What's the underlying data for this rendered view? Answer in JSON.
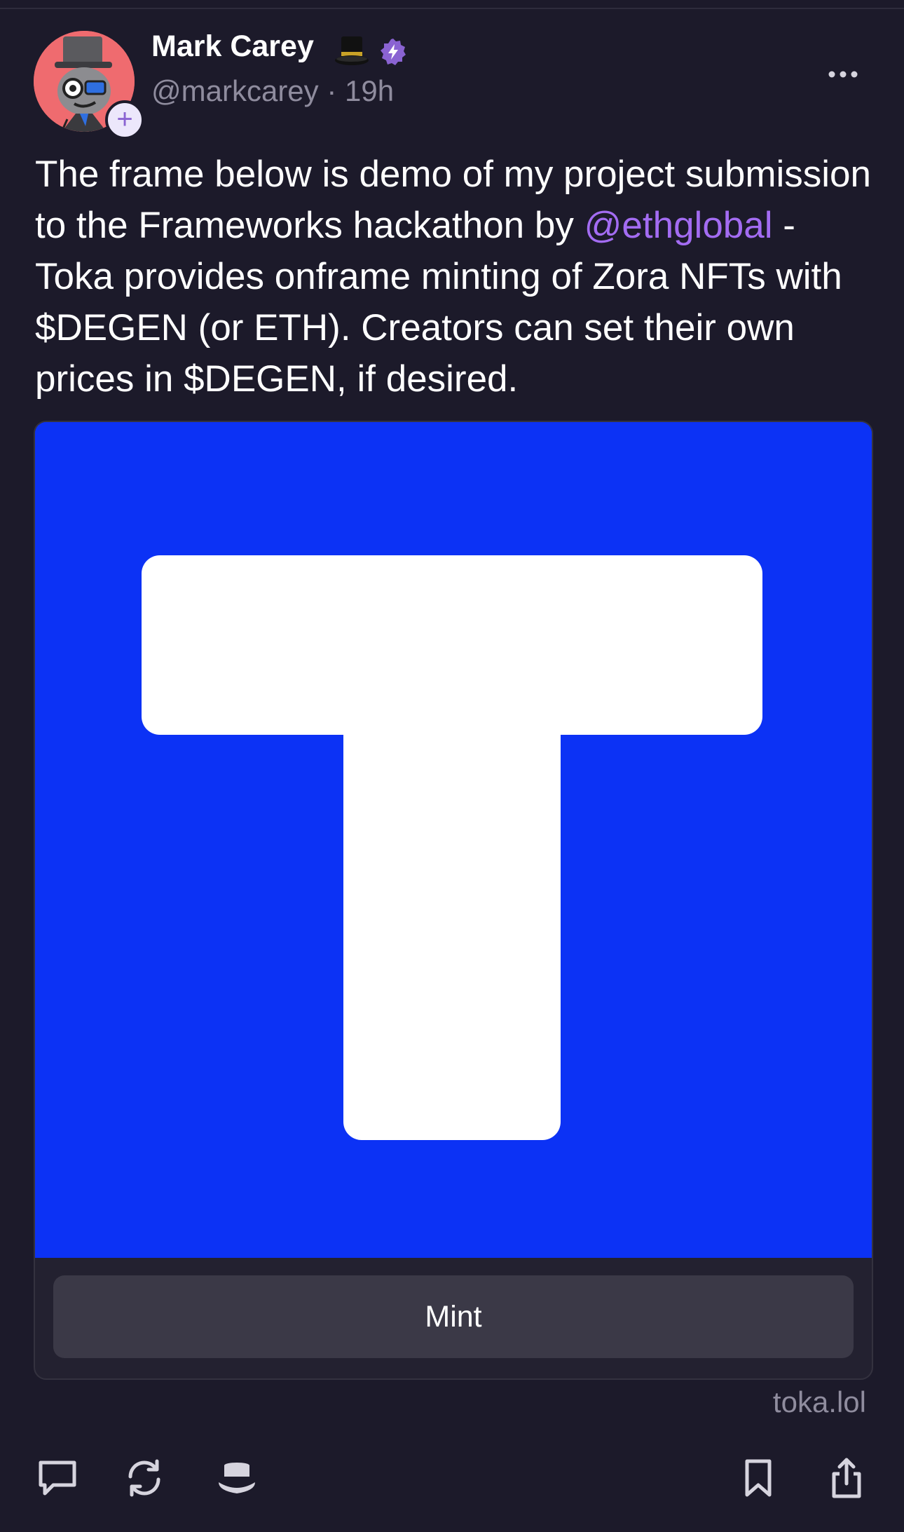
{
  "author": {
    "display_name": "Mark Carey",
    "name_icon": "top-hat-icon",
    "badge_icon": "power-badge-icon",
    "handle": "@markcarey",
    "separator": "·",
    "time_ago": "19h",
    "avatar_bg": "#ef6b6f",
    "follow_icon": "plus-icon",
    "follow_glyph": "+"
  },
  "post": {
    "text_before": "The frame below is demo of my project submission to the Frameworks hackathon by ",
    "mention": "@ethglobal",
    "text_after": " - Toka provides onframe minting of Zora NFTs with $DEGEN (or ETH). Creators can set their own prices in $DEGEN, if desired."
  },
  "frame": {
    "image_bg": "#0c32f5",
    "image_icon": "toka-t-logo",
    "button_label": "Mint",
    "domain": "toka.lol"
  },
  "actions": {
    "reply_icon": "reply-icon",
    "recast_icon": "recast-icon",
    "tip_icon": "tip-hat-icon",
    "bookmark_icon": "bookmark-icon",
    "share_icon": "share-icon"
  },
  "colors": {
    "background": "#1c1a2a",
    "accent": "#a36cf2",
    "muted_text": "#8f8c9e",
    "badge": "#8a63d2"
  }
}
